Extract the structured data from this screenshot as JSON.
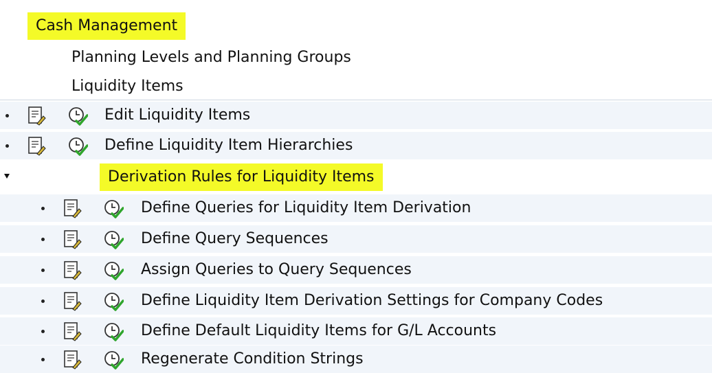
{
  "tree": {
    "header": "Cash Management",
    "level1": [
      "Planning Levels and Planning Groups",
      "Liquidity Items"
    ],
    "activities1": [
      {
        "label": "Edit Liquidity Items",
        "doc_icon": "document-icon",
        "exec_icon": "execute-clock-icon"
      },
      {
        "label": "Define Liquidity Item Hierarchies",
        "doc_icon": "document-icon",
        "exec_icon": "execute-clock-icon"
      }
    ],
    "expanded_folder": "Derivation Rules for Liquidity Items",
    "activities2": [
      {
        "label": "Define Queries for Liquidity Item Derivation"
      },
      {
        "label": "Define Query Sequences"
      },
      {
        "label": "Assign Queries to Query Sequences"
      },
      {
        "label": "Define Liquidity Item Derivation Settings for Company Codes"
      },
      {
        "label": "Define Default Liquidity Items for G/L Accounts"
      },
      {
        "label": "Regenerate Condition Strings"
      }
    ]
  },
  "colors": {
    "highlight": "#f4fa28",
    "row_background": "#f1f5fa",
    "check_green": "#2fa52c"
  }
}
